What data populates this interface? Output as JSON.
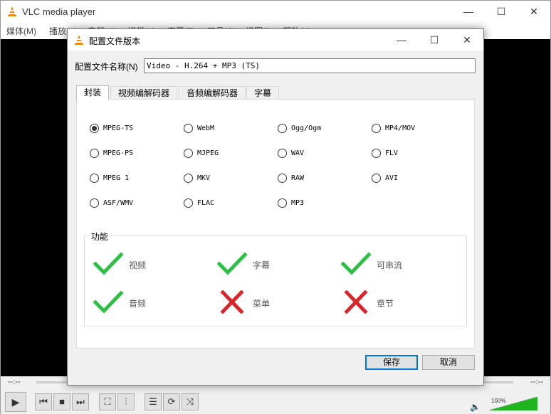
{
  "main_window": {
    "title": "VLC media player",
    "window_controls": {
      "minimize": "—",
      "maximize": "☐",
      "close": "✕"
    },
    "menu": [
      "媒体(M)",
      "播放(L)",
      "音频(A)",
      "视频(V)",
      "字幕(T)",
      "工具(S)",
      "视图(I)",
      "帮助(H)"
    ],
    "seek": {
      "elapsed": "--:--",
      "remaining": "--:--"
    },
    "controls": {
      "play": "▶",
      "prev": "⏮",
      "stop": "■",
      "next": "⏭",
      "fullscreen": "⛶",
      "ext_settings": "⫶",
      "playlist": "☰",
      "loop": "⟳",
      "random": "⤨"
    },
    "volume": {
      "label": "100%",
      "level": 1.0
    }
  },
  "dialog": {
    "title": "配置文件版本",
    "window_controls": {
      "minimize": "—",
      "maximize": "☐",
      "close": "✕"
    },
    "profile_name_label": "配置文件名称(N)",
    "profile_name_value": "Video - H.264 + MP3 (TS)",
    "tabs": [
      "封装",
      "视频编解码器",
      "音频编解码器",
      "字幕"
    ],
    "active_tab": 0,
    "containers": [
      {
        "label": "MPEG-TS",
        "checked": true
      },
      {
        "label": "WebM",
        "checked": false
      },
      {
        "label": "Ogg/Ogm",
        "checked": false
      },
      {
        "label": "MP4/MOV",
        "checked": false
      },
      {
        "label": "MPEG-PS",
        "checked": false
      },
      {
        "label": "MJPEG",
        "checked": false
      },
      {
        "label": "WAV",
        "checked": false
      },
      {
        "label": "FLV",
        "checked": false
      },
      {
        "label": "MPEG 1",
        "checked": false
      },
      {
        "label": "MKV",
        "checked": false
      },
      {
        "label": "RAW",
        "checked": false
      },
      {
        "label": "AVI",
        "checked": false
      },
      {
        "label": "ASF/WMV",
        "checked": false
      },
      {
        "label": "FLAC",
        "checked": false
      },
      {
        "label": "MP3",
        "checked": false
      }
    ],
    "features_title": "功能",
    "features": [
      {
        "label": "视频",
        "supported": true
      },
      {
        "label": "字幕",
        "supported": true
      },
      {
        "label": "可串流",
        "supported": true
      },
      {
        "label": "音频",
        "supported": true
      },
      {
        "label": "菜单",
        "supported": false
      },
      {
        "label": "章节",
        "supported": false
      }
    ],
    "colors": {
      "check": "#2fbf46",
      "cross": "#d9242a"
    },
    "save_label": "保存",
    "cancel_label": "取消"
  }
}
